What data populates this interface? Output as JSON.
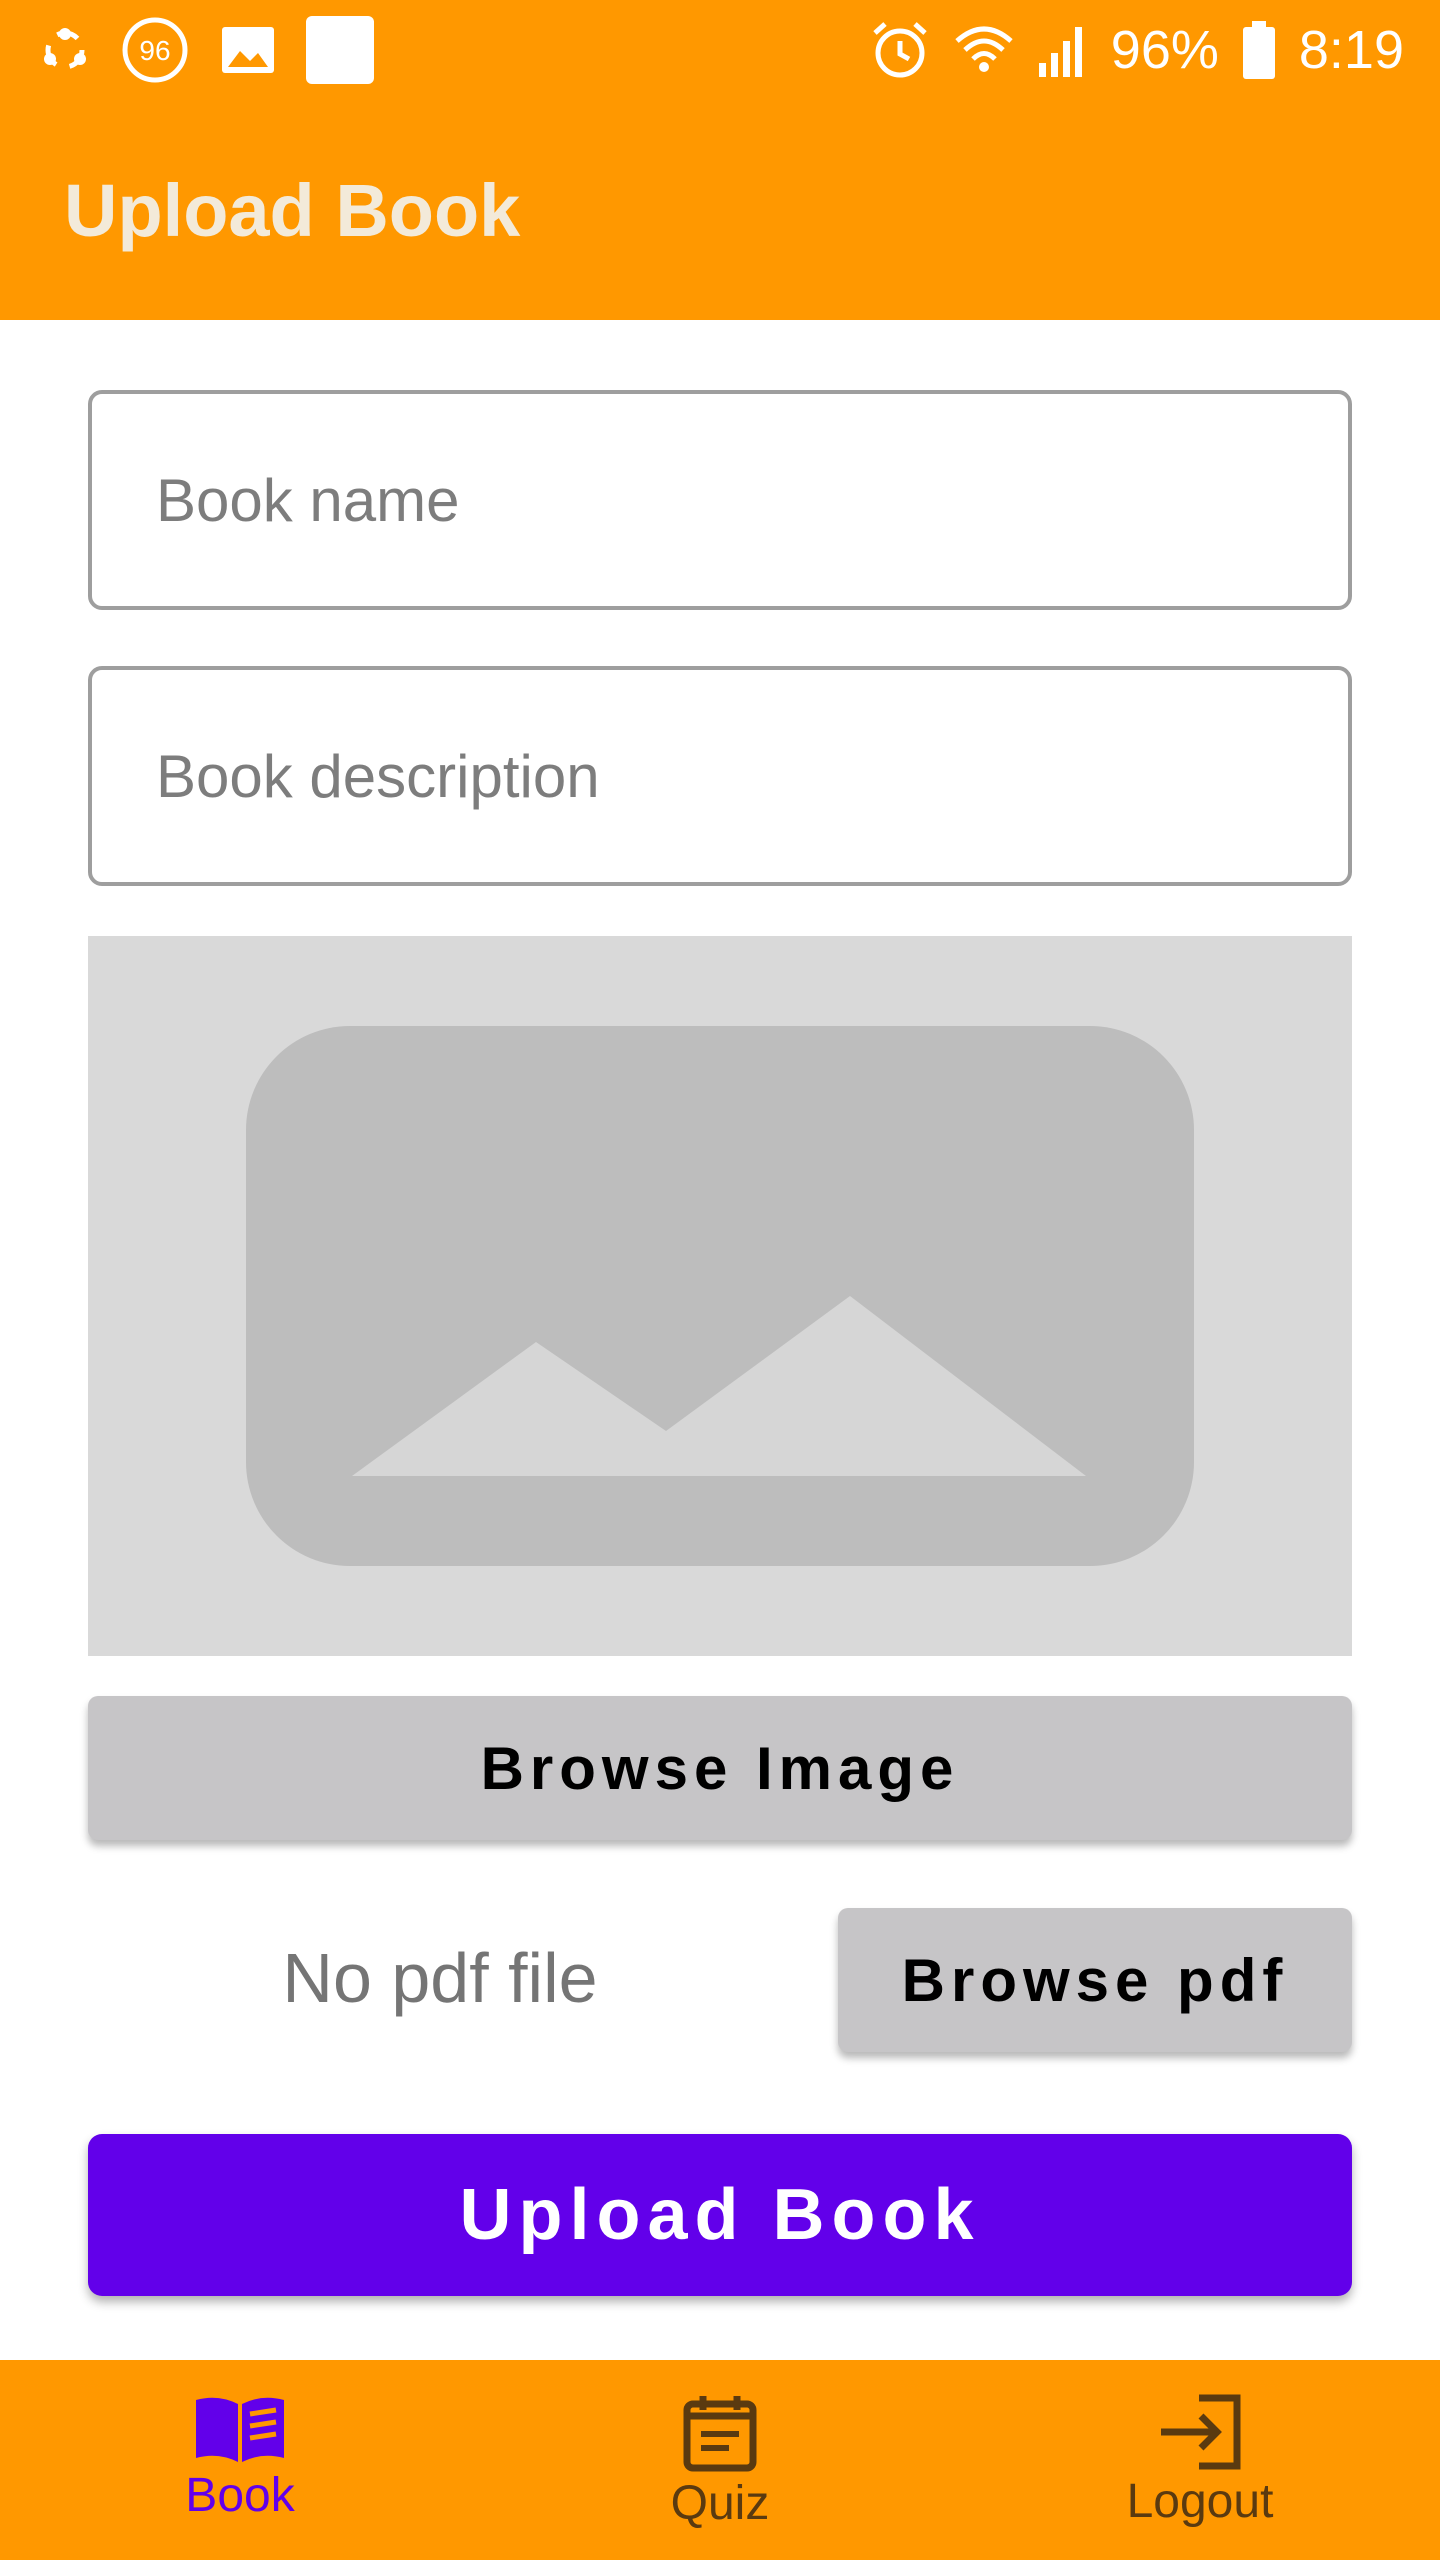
{
  "status_bar": {
    "battery": "96%",
    "time": "8:19",
    "notification_badge": "96",
    "icons_left": [
      "share-icon",
      "badge-96-icon",
      "image-icon",
      "square-icon"
    ],
    "icons_right": [
      "alarm-icon",
      "wifi-icon",
      "signal-icon",
      "battery-icon"
    ]
  },
  "app_bar": {
    "title": "Upload Book"
  },
  "form": {
    "book_name": {
      "placeholder": "Book name",
      "value": ""
    },
    "book_description": {
      "placeholder": "Book description",
      "value": ""
    },
    "image_preview": {
      "icon": "image-placeholder-icon"
    },
    "browse_image_label": "Browse Image",
    "pdf_status": "No pdf file",
    "browse_pdf_label": "Browse pdf",
    "upload_label": "Upload Book"
  },
  "bottom_nav": {
    "items": [
      {
        "label": "Book",
        "icon": "book-icon",
        "active": true
      },
      {
        "label": "Quiz",
        "icon": "quiz-icon",
        "active": false
      },
      {
        "label": "Logout",
        "icon": "logout-icon",
        "active": false
      }
    ]
  },
  "colors": {
    "primary_orange": "#ff9800",
    "accent_purple": "#6200ea",
    "button_gray": "#c6c5c7",
    "preview_gray": "#d9d9d9"
  }
}
